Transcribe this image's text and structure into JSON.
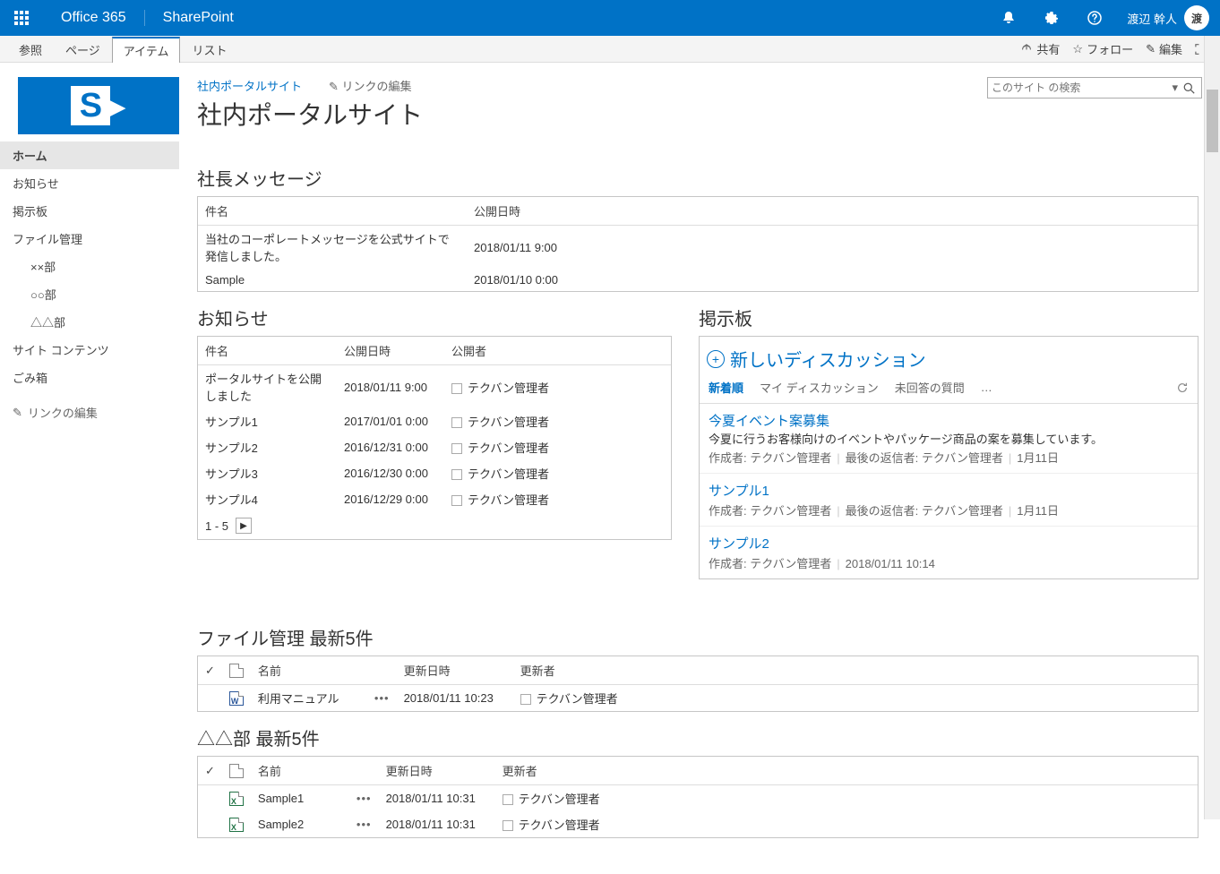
{
  "suite": {
    "office": "Office 365",
    "app": "SharePoint",
    "username": "渡辺 幹人",
    "avatar_initial": "渡"
  },
  "ribbon": {
    "tabs": [
      "参照",
      "ページ",
      "アイテム",
      "リスト"
    ],
    "active_index": 2,
    "actions": {
      "share": "共有",
      "follow": "フォロー",
      "edit": "編集"
    }
  },
  "breadcrumb": {
    "site_link": "社内ポータルサイト",
    "edit_links": "リンクの編集"
  },
  "page_title": "社内ポータルサイト",
  "search": {
    "placeholder": "このサイト の検索"
  },
  "leftnav": {
    "items": [
      {
        "label": "ホーム",
        "selected": true
      },
      {
        "label": "お知らせ"
      },
      {
        "label": "掲示板"
      },
      {
        "label": "ファイル管理"
      },
      {
        "label": "××部",
        "sub": true
      },
      {
        "label": "○○部",
        "sub": true
      },
      {
        "label": "△△部",
        "sub": true
      },
      {
        "label": "サイト コンテンツ"
      },
      {
        "label": "ごみ箱"
      }
    ],
    "edit_links": "リンクの編集"
  },
  "president_msg": {
    "title": "社長メッセージ",
    "headers": {
      "subject": "件名",
      "published": "公開日時"
    },
    "rows": [
      {
        "subject": "当社のコーポレートメッセージを公式サイトで発信しました。",
        "published": "2018/01/11 9:00"
      },
      {
        "subject": "Sample",
        "published": "2018/01/10 0:00"
      }
    ]
  },
  "announcements": {
    "title": "お知らせ",
    "headers": {
      "subject": "件名",
      "published": "公開日時",
      "publisher": "公開者"
    },
    "rows": [
      {
        "subject": "ポータルサイトを公開しました",
        "published": "2018/01/11 9:00",
        "publisher": "テクバン管理者"
      },
      {
        "subject": "サンプル1",
        "published": "2017/01/01 0:00",
        "publisher": "テクバン管理者"
      },
      {
        "subject": "サンプル2",
        "published": "2016/12/31 0:00",
        "publisher": "テクバン管理者"
      },
      {
        "subject": "サンプル3",
        "published": "2016/12/30 0:00",
        "publisher": "テクバン管理者"
      },
      {
        "subject": "サンプル4",
        "published": "2016/12/29 0:00",
        "publisher": "テクバン管理者"
      }
    ],
    "pager_text": "1 - 5"
  },
  "discussion": {
    "title": "掲示板",
    "new_label": "新しいディスカッション",
    "tabs": {
      "recent": "新着順",
      "mine": "マイ ディスカッション",
      "unanswered": "未回答の質問",
      "more": "…"
    },
    "items": [
      {
        "title": "今夏イベント案募集",
        "body": "今夏に行うお客様向けのイベントやパッケージ商品の案を募集しています。",
        "author_label": "作成者:",
        "author": "テクバン管理者",
        "lastreply_label": "最後の返信者:",
        "lastreply": "テクバン管理者",
        "date": "1月11日"
      },
      {
        "title": "サンプル1",
        "author_label": "作成者:",
        "author": "テクバン管理者",
        "lastreply_label": "最後の返信者:",
        "lastreply": "テクバン管理者",
        "date": "1月11日"
      },
      {
        "title": "サンプル2",
        "author_label": "作成者:",
        "author": "テクバン管理者",
        "date": "2018/01/11 10:14"
      }
    ]
  },
  "files": {
    "title": "ファイル管理 最新5件",
    "headers": {
      "name": "名前",
      "modified": "更新日時",
      "modifier": "更新者"
    },
    "rows": [
      {
        "icon": "word",
        "name": "利用マニュアル",
        "modified": "2018/01/11 10:23",
        "modifier": "テクバン管理者"
      }
    ]
  },
  "dept_files": {
    "title": "△△部 最新5件",
    "headers": {
      "name": "名前",
      "modified": "更新日時",
      "modifier": "更新者"
    },
    "rows": [
      {
        "icon": "excel",
        "name": "Sample1",
        "modified": "2018/01/11 10:31",
        "modifier": "テクバン管理者"
      },
      {
        "icon": "excel",
        "name": "Sample2",
        "modified": "2018/01/11 10:31",
        "modifier": "テクバン管理者"
      }
    ]
  }
}
